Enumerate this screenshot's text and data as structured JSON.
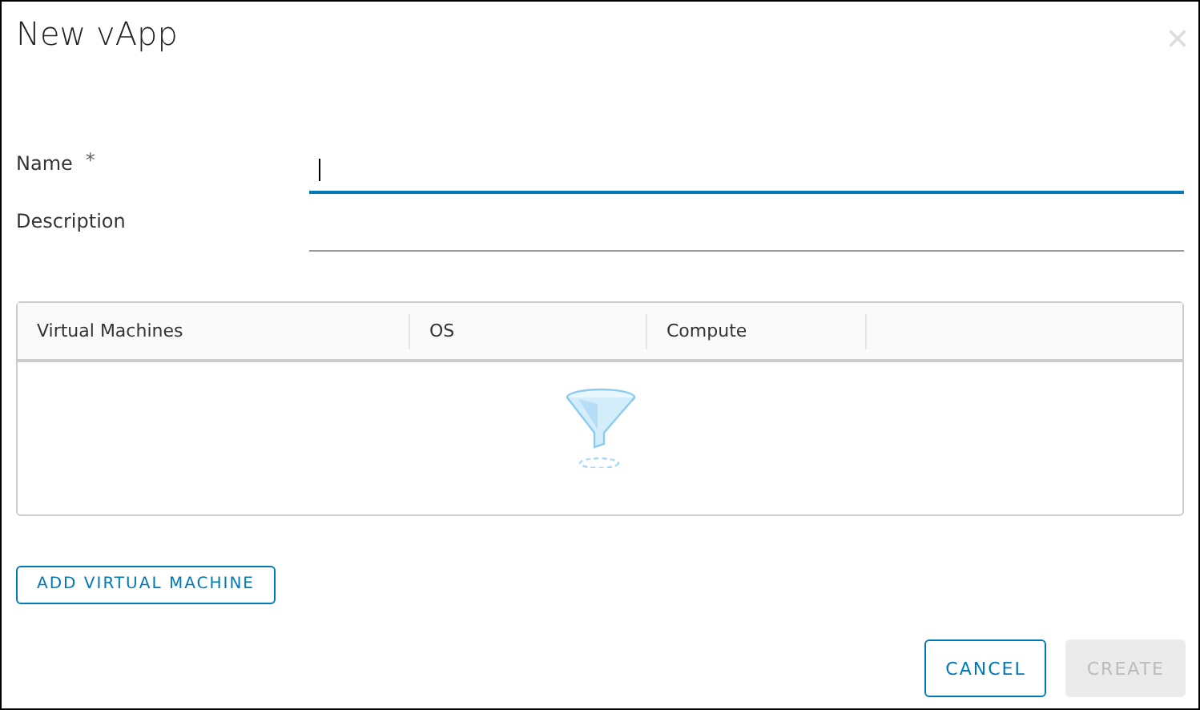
{
  "dialog": {
    "title": "New vApp",
    "close_label": "×"
  },
  "fields": [
    {
      "label": "Name",
      "required_mark": "*",
      "focused": true
    },
    {
      "label": "Description",
      "focused": false
    }
  ],
  "table": {
    "columns": [
      "Virtual Machines",
      "OS",
      "Compute"
    ],
    "empty": true
  },
  "add_button": {
    "label": "ADD VIRTUAL MACHINE"
  },
  "buttons": [
    {
      "label": "CANCEL",
      "kind": "outline",
      "disabled": false
    },
    {
      "label": "CREATE",
      "kind": "primary",
      "disabled": true
    }
  ]
}
